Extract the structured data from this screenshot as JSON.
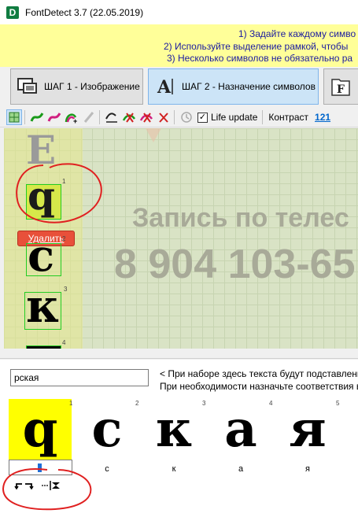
{
  "window": {
    "title": "FontDetect 3.7 (22.05.2019)",
    "logo_letter": "D"
  },
  "hints": {
    "line1": "1) Задайте каждому симво",
    "line2": "2) Используйте выделение рамкой, чтобы",
    "line3": "3) Несколько символов не обязательно ра"
  },
  "steps": {
    "step1_label": "ШАГ 1 - Изображение",
    "step2_label": "ШАГ 2 - Назначение символов",
    "step3_letter": "F"
  },
  "toolbar": {
    "life_update_label": "Life update",
    "life_update_checked": true,
    "contrast_label": "Контраст",
    "contrast_value": "121"
  },
  "canvas": {
    "bg_text_line1": "Запись по телес",
    "bg_text_line2": "8 904 103-65",
    "glyphs": [
      {
        "char": "Е",
        "number": ""
      },
      {
        "char": "q",
        "number": "1"
      },
      {
        "char": "с",
        "number": "2"
      },
      {
        "char": "к",
        "number": "3"
      },
      {
        "char": "",
        "number": "4"
      }
    ],
    "delete_label": "Удалить"
  },
  "mapping": {
    "input_value": "рская",
    "hint_line1": "< При наборе здесь текста будут подставлены",
    "hint_line2": "При необходимости назначьте соответствия в",
    "cells": [
      {
        "glyph": "q",
        "number": "1",
        "label": "",
        "highlight": true
      },
      {
        "glyph": "с",
        "number": "2",
        "label": "с",
        "highlight": false
      },
      {
        "glyph": "к",
        "number": "3",
        "label": "к",
        "highlight": false
      },
      {
        "glyph": "а",
        "number": "4",
        "label": "а",
        "highlight": false
      },
      {
        "glyph": "я",
        "number": "5",
        "label": "я",
        "highlight": false
      }
    ]
  },
  "colors": {
    "hint_bg": "#ffff99",
    "highlight_yellow": "#ffff00",
    "annotation_red": "#e02020",
    "active_step": "#cce4f7"
  }
}
